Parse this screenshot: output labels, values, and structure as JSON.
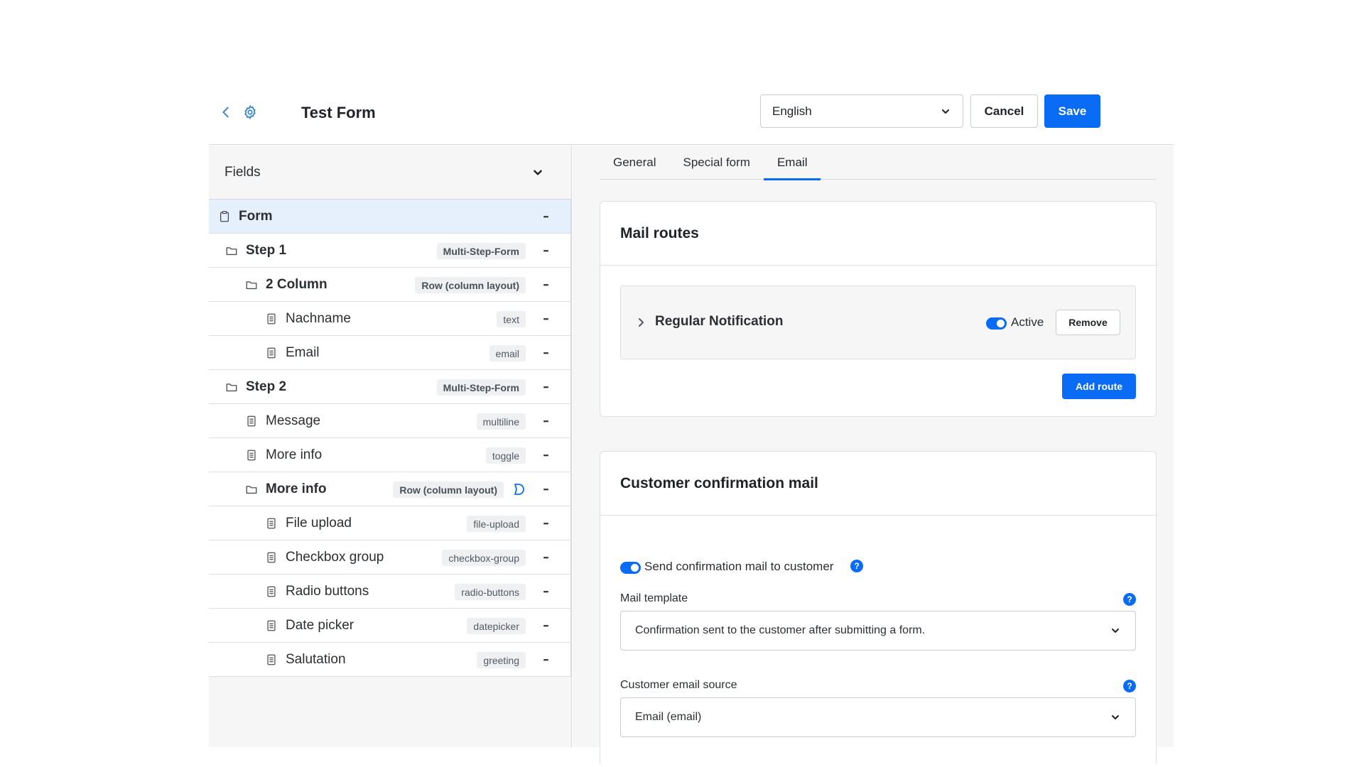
{
  "header": {
    "title": "Test Form",
    "language": "English",
    "cancel_label": "Cancel",
    "save_label": "Save"
  },
  "fields_panel": {
    "title": "Fields",
    "rows": [
      {
        "label": "Form",
        "badge": "",
        "level": 0,
        "type": "form",
        "bold": true,
        "selected": true
      },
      {
        "label": "Step 1",
        "badge": "Multi-Step-Form",
        "level": 1,
        "type": "folder",
        "bold": true
      },
      {
        "label": "2 Column",
        "badge": "Row (column layout)",
        "level": 2,
        "type": "folder",
        "bold": true
      },
      {
        "label": "Nachname",
        "badge": "text",
        "level": 3,
        "type": "field"
      },
      {
        "label": "Email",
        "badge": "email",
        "level": 3,
        "type": "field"
      },
      {
        "label": "Step 2",
        "badge": "Multi-Step-Form",
        "level": 1,
        "type": "folder",
        "bold": true
      },
      {
        "label": "Message",
        "badge": "multiline",
        "level": 2,
        "type": "field"
      },
      {
        "label": "More info",
        "badge": "toggle",
        "level": 2,
        "type": "field"
      },
      {
        "label": "More info",
        "badge": "Row (column layout)",
        "level": 2,
        "type": "folder",
        "bold": true,
        "conditional": true
      },
      {
        "label": "File upload",
        "badge": "file-upload",
        "level": 3,
        "type": "field"
      },
      {
        "label": "Checkbox group",
        "badge": "checkbox-group",
        "level": 3,
        "type": "field"
      },
      {
        "label": "Radio buttons",
        "badge": "radio-buttons",
        "level": 3,
        "type": "field"
      },
      {
        "label": "Date picker",
        "badge": "datepicker",
        "level": 3,
        "type": "field"
      },
      {
        "label": "Salutation",
        "badge": "greeting",
        "level": 3,
        "type": "field"
      }
    ]
  },
  "tabs": [
    {
      "label": "General",
      "active": false
    },
    {
      "label": "Special form",
      "active": false
    },
    {
      "label": "Email",
      "active": true
    }
  ],
  "mail_routes": {
    "title": "Mail routes",
    "route_name": "Regular Notification",
    "active_label": "Active",
    "active": true,
    "remove_label": "Remove",
    "add_label": "Add route"
  },
  "confirmation": {
    "title": "Customer confirmation mail",
    "send_label": "Send confirmation mail to customer",
    "send_enabled": true,
    "template_label": "Mail template",
    "template_value": "Confirmation sent to the customer after submitting a form.",
    "source_label": "Customer email source",
    "source_value": "Email (email)"
  },
  "colors": {
    "accent": "#0a6cf5",
    "selected_row": "#e6effc",
    "panel_bg": "#f6f6f7",
    "border": "#d6d9de"
  },
  "icons": {
    "back": "chevron-left-icon",
    "settings": "gear-icon",
    "form": "clipboard-icon",
    "folder": "folder-icon",
    "field": "document-icon",
    "more": "more-dots-icon",
    "condition": "condition-icon",
    "help": "help-icon"
  }
}
